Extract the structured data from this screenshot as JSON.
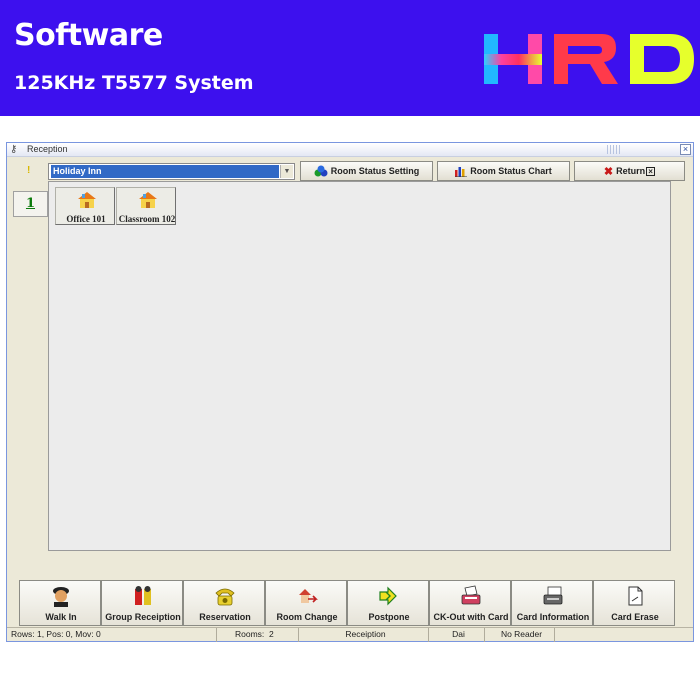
{
  "banner": {
    "title": "Software",
    "subtitle": "125KHz T5577 System",
    "logo_text": "HRD",
    "background": "#3d10ee"
  },
  "window": {
    "title": "Reception",
    "title_icon": "key-icon",
    "row_marker": "!",
    "row_tab": "1",
    "hotel": {
      "selected": "Holiday Inn"
    },
    "top_buttons": {
      "room_status_setting": "Room Status Setting",
      "room_status_chart": "Room Status Chart",
      "return": "Return"
    },
    "rooms": [
      {
        "label": "Office 101",
        "icon": "house-icon"
      },
      {
        "label": "Classroom 102",
        "icon": "house-icon"
      }
    ],
    "toolbar": [
      {
        "label": "Walk In",
        "icon": "guest-icon"
      },
      {
        "label": "Group Receiption",
        "icon": "group-icon"
      },
      {
        "label": "Reservation",
        "icon": "telephone-icon"
      },
      {
        "label": "Room Change",
        "icon": "room-change-icon"
      },
      {
        "label": "Postpone",
        "icon": "arrow-forward-icon"
      },
      {
        "label": "CK-Out with Card",
        "icon": "card-reader-icon"
      },
      {
        "label": "Card Information",
        "icon": "card-info-icon"
      },
      {
        "label": "Card Erase",
        "icon": "card-erase-icon"
      }
    ],
    "status": {
      "position": "Rows: 1, Pos: 0, Mov: 0",
      "rooms_label": "Rooms:",
      "rooms_count": "2",
      "mode": "Receiption",
      "user": "Dai",
      "reader": "No Reader"
    }
  }
}
